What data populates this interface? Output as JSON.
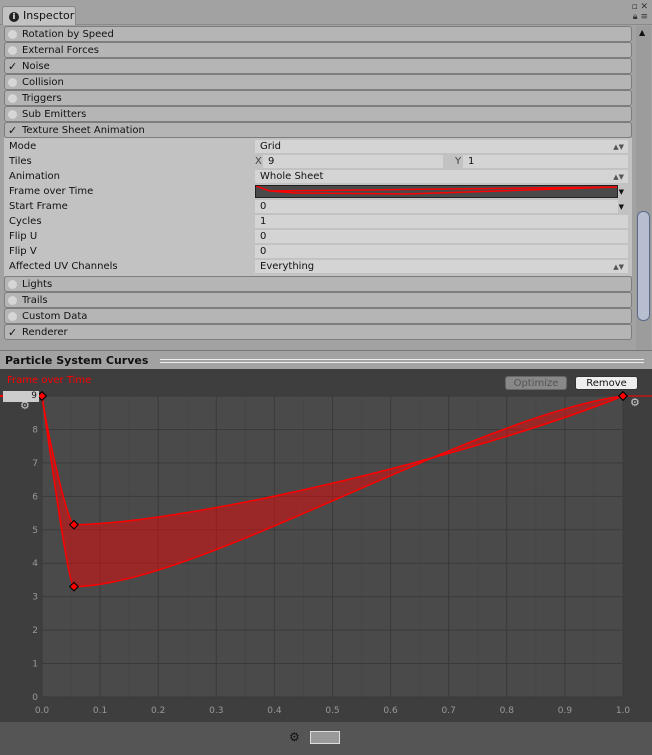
{
  "tab": {
    "title": "Inspector"
  },
  "modules_top": [
    {
      "label": "Rotation by Speed",
      "enabled": false
    },
    {
      "label": "External Forces",
      "enabled": false
    },
    {
      "label": "Noise",
      "enabled": true
    },
    {
      "label": "Collision",
      "enabled": false
    },
    {
      "label": "Triggers",
      "enabled": false
    },
    {
      "label": "Sub Emitters",
      "enabled": false
    },
    {
      "label": "Texture Sheet Animation",
      "enabled": true
    }
  ],
  "props": {
    "mode": {
      "label": "Mode",
      "value": "Grid"
    },
    "tiles": {
      "label": "Tiles",
      "x_label": "X",
      "x": "9",
      "y_label": "Y",
      "y": "1"
    },
    "animation": {
      "label": "Animation",
      "value": "Whole Sheet"
    },
    "frame_over_time": {
      "label": "Frame over Time"
    },
    "start_frame": {
      "label": "Start Frame",
      "value": "0"
    },
    "cycles": {
      "label": "Cycles",
      "value": "1"
    },
    "flip_u": {
      "label": "Flip U",
      "value": "0"
    },
    "flip_v": {
      "label": "Flip V",
      "value": "0"
    },
    "uv": {
      "label": "Affected UV Channels",
      "value": "Everything"
    }
  },
  "modules_bottom": [
    {
      "label": "Lights",
      "enabled": false
    },
    {
      "label": "Trails",
      "enabled": false
    },
    {
      "label": "Custom Data",
      "enabled": false
    },
    {
      "label": "Renderer",
      "enabled": true
    }
  ],
  "curves": {
    "title": "Particle System Curves",
    "curve_label": "Frame over Time",
    "optimize": "Optimize",
    "remove": "Remove",
    "value_field": "9",
    "curve_color": "#ff0000"
  },
  "chart_data": {
    "type": "area",
    "xlim": [
      0,
      1
    ],
    "ylim": [
      0,
      9
    ],
    "x_ticks": [
      "0.0",
      "0.1",
      "0.2",
      "0.3",
      "0.4",
      "0.5",
      "0.6",
      "0.7",
      "0.8",
      "0.9",
      "1.0"
    ],
    "y_ticks": [
      "0",
      "1",
      "2",
      "3",
      "4",
      "5",
      "6",
      "7",
      "8",
      "9"
    ],
    "grid": true,
    "series": [
      {
        "keys": [
          [
            0,
            9
          ],
          [
            0.055,
            5.15
          ],
          [
            1,
            9
          ]
        ]
      },
      {
        "keys": [
          [
            0,
            9
          ],
          [
            0.055,
            3.3
          ],
          [
            1,
            9
          ]
        ]
      }
    ]
  }
}
